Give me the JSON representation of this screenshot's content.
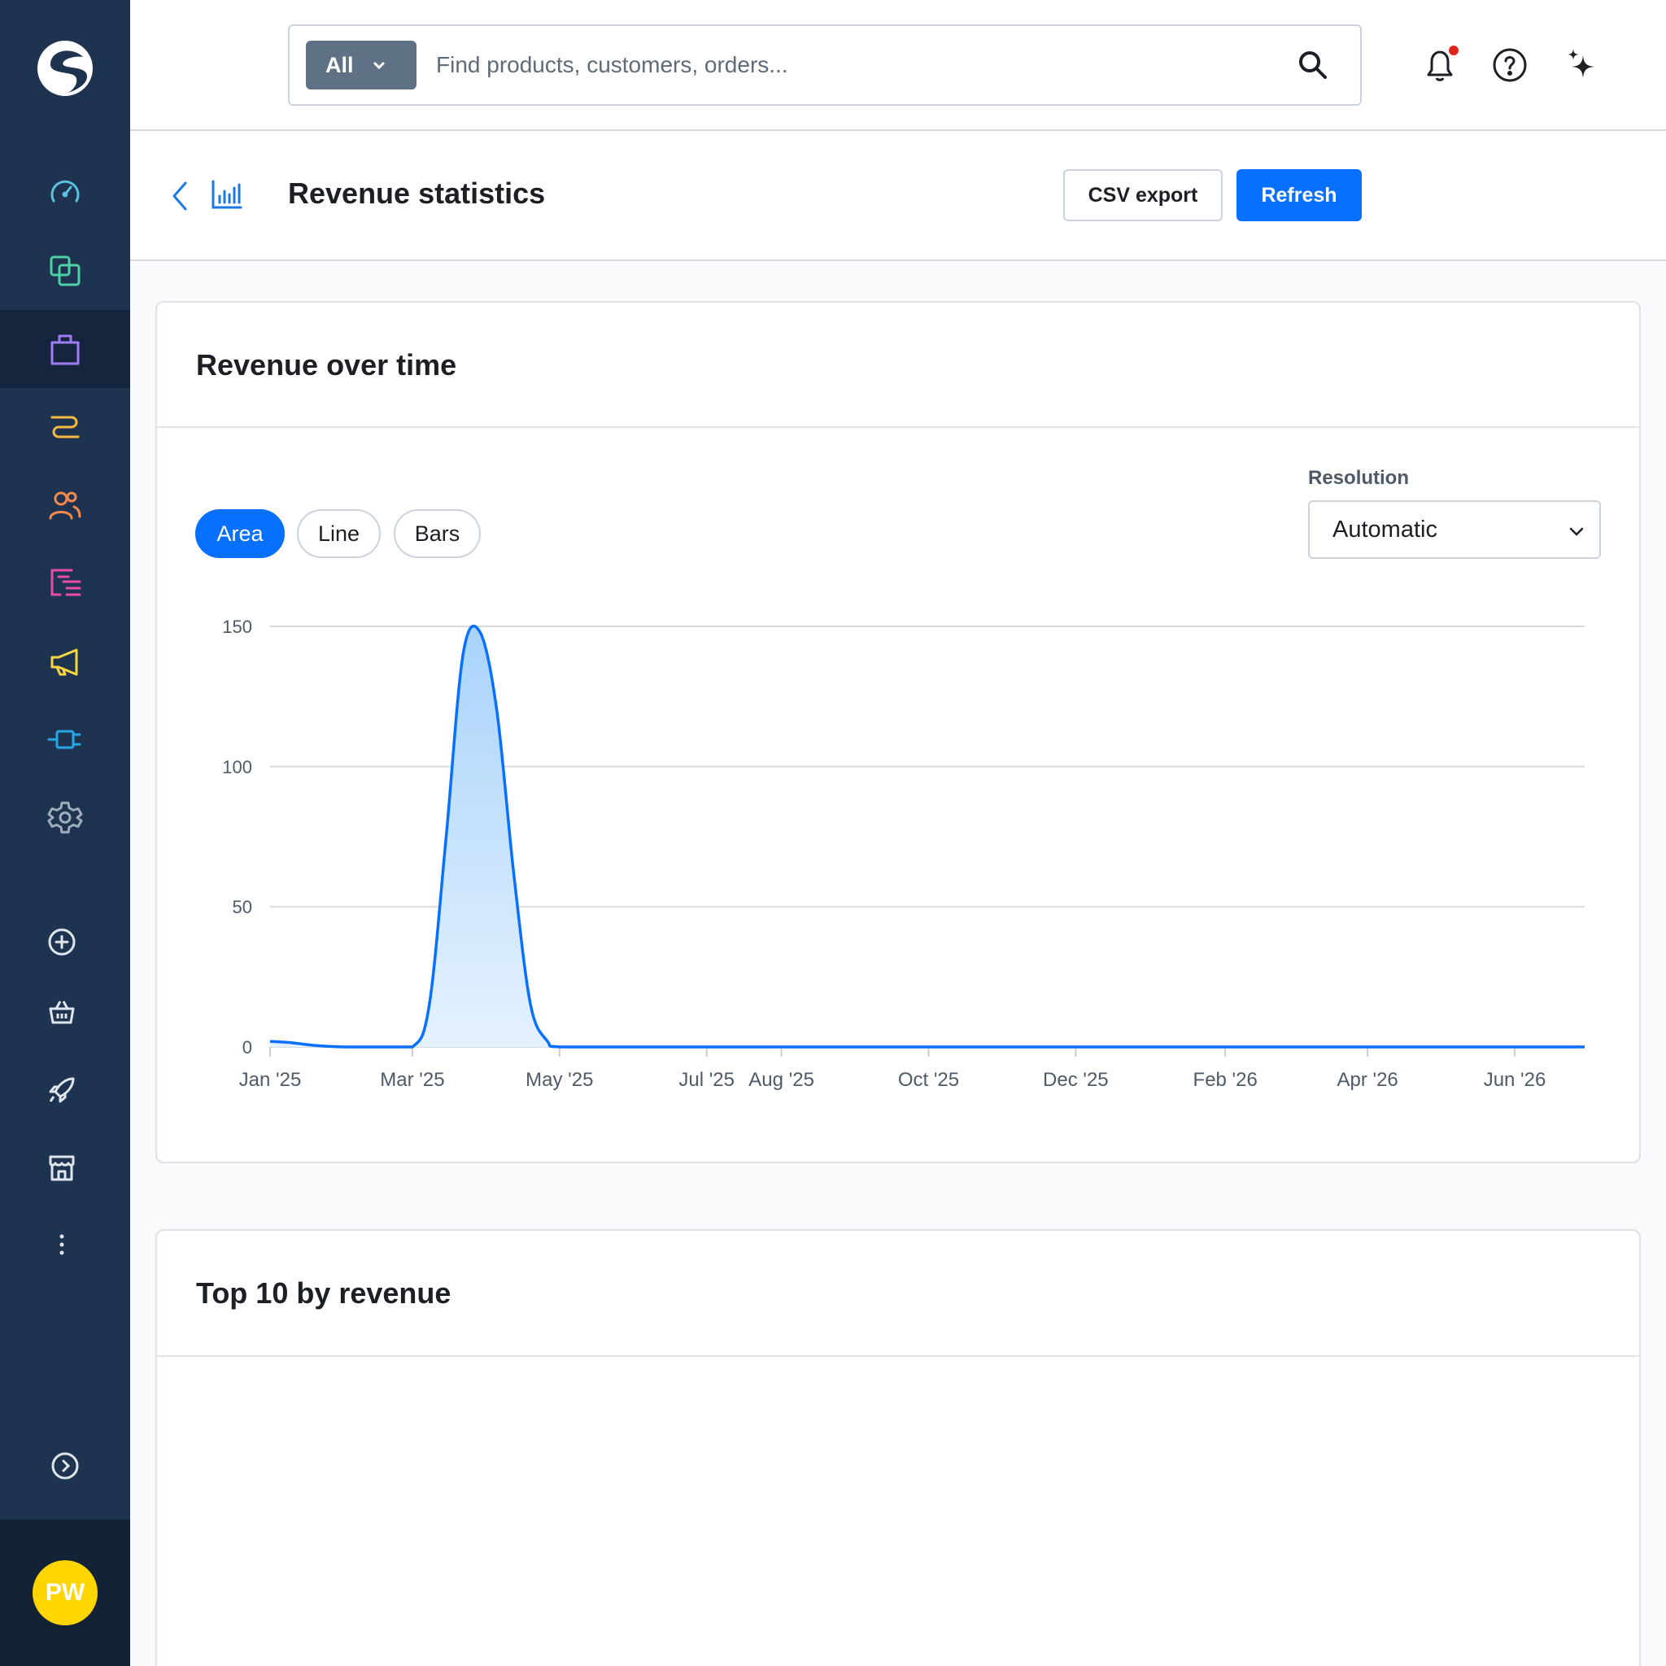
{
  "sidebar": {
    "items": [
      {
        "icon": "dashboard-icon",
        "color": "#5bc0de"
      },
      {
        "icon": "catalogue-icon",
        "color": "#4cd1a5"
      },
      {
        "icon": "orders-bag-icon",
        "color": "#a07cf5"
      },
      {
        "icon": "customers-route-icon",
        "color": "#f5b942"
      },
      {
        "icon": "users-icon",
        "color": "#f58a4c"
      },
      {
        "icon": "content-icon",
        "color": "#e94ba5"
      },
      {
        "icon": "marketing-megaphone-icon",
        "color": "#f5d642"
      },
      {
        "icon": "extensions-plug-icon",
        "color": "#26a7e6"
      },
      {
        "icon": "settings-gear-icon",
        "color": "#a0adbb"
      }
    ],
    "active_index": 2,
    "avatar_initials": "PW"
  },
  "topbar": {
    "search_scope": "All",
    "search_placeholder": "Find products, customers, orders..."
  },
  "header": {
    "title": "Revenue statistics",
    "csv_label": "CSV export",
    "refresh_label": "Refresh"
  },
  "revenue_card": {
    "title": "Revenue over time",
    "tabs": [
      "Area",
      "Line",
      "Bars"
    ],
    "active_tab": "Area",
    "resolution_label": "Resolution",
    "resolution_value": "Automatic"
  },
  "top10_card": {
    "title": "Top 10 by revenue"
  },
  "chart_data": {
    "type": "area",
    "title": "",
    "xlabel": "",
    "ylabel": "",
    "ylim": [
      0,
      150
    ],
    "yticks": [
      0,
      50,
      100,
      150
    ],
    "xticks": [
      "Jan '25",
      "Mar '25",
      "May '25",
      "Jul '25",
      "Aug '25",
      "Oct '25",
      "Dec '25",
      "Feb '26",
      "Apr '26",
      "Jun '26"
    ],
    "xtick_dates": [
      "2025-01-01",
      "2025-03-01",
      "2025-05-01",
      "2025-07-01",
      "2025-08-01",
      "2025-10-01",
      "2025-12-01",
      "2026-02-01",
      "2026-04-01",
      "2026-06-01"
    ],
    "xlim": [
      "2025-01-01",
      "2026-06-30"
    ],
    "grid": true,
    "color": "#0870ff",
    "series": [
      {
        "x": [
          "2025-01-01",
          "2025-01-10",
          "2025-01-20",
          "2025-02-01",
          "2025-02-15",
          "2025-03-01",
          "2025-03-08",
          "2025-03-15",
          "2025-03-22",
          "2025-03-29",
          "2025-04-05",
          "2025-04-12",
          "2025-04-19",
          "2025-04-26",
          "2025-05-01",
          "2025-06-01",
          "2025-08-01",
          "2025-10-01",
          "2025-12-01",
          "2026-02-01",
          "2026-04-01",
          "2026-06-30"
        ],
        "y": [
          2,
          1.5,
          0.5,
          0,
          0,
          0,
          15,
          75,
          140,
          148,
          120,
          62,
          15,
          2,
          0,
          0,
          0,
          0,
          0,
          0,
          0,
          0
        ]
      }
    ]
  }
}
